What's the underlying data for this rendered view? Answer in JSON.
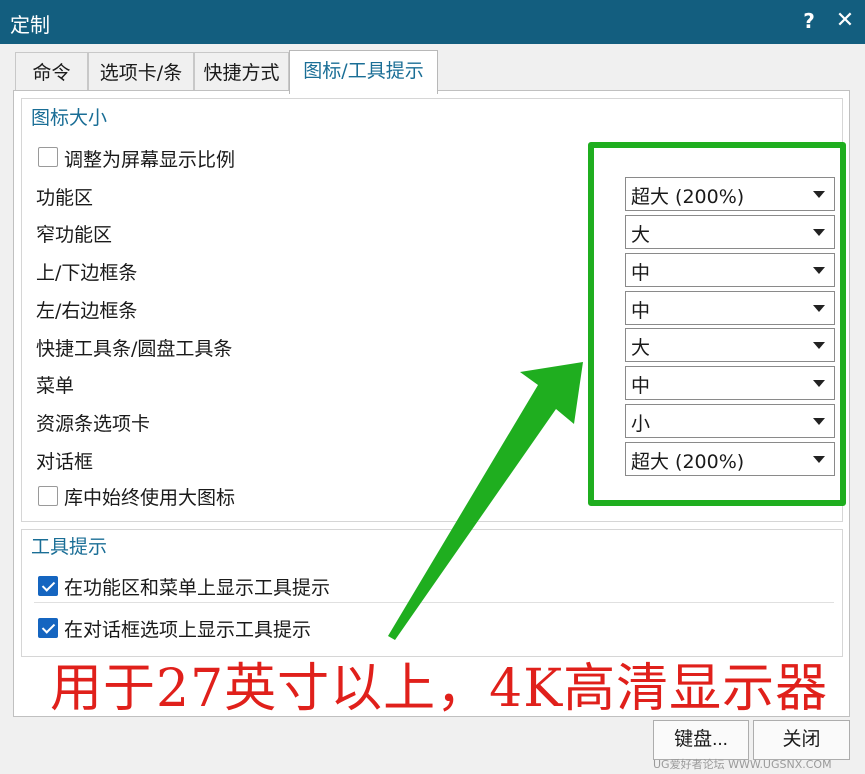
{
  "window": {
    "title": "定制",
    "help_label": "?",
    "close_label": "✕"
  },
  "tabs": [
    {
      "label": "命令"
    },
    {
      "label": "选项卡/条"
    },
    {
      "label": "快捷方式"
    },
    {
      "label": "图标/工具提示",
      "active": true
    }
  ],
  "icon_size": {
    "title": "图标大小",
    "scale_checkbox": {
      "label": "调整为屏幕显示比例",
      "checked": false
    },
    "rows": [
      {
        "label": "功能区",
        "value": "超大 (200%)"
      },
      {
        "label": "窄功能区",
        "value": "大"
      },
      {
        "label": "上/下边框条",
        "value": "中"
      },
      {
        "label": "左/右边框条",
        "value": "中"
      },
      {
        "label": "快捷工具条/圆盘工具条",
        "value": "大"
      },
      {
        "label": "菜单",
        "value": "中"
      },
      {
        "label": "资源条选项卡",
        "value": "小"
      },
      {
        "label": "对话框",
        "value": "超大 (200%)"
      }
    ],
    "library_checkbox": {
      "label": "库中始终使用大图标",
      "checked": false
    }
  },
  "tooltips": {
    "title": "工具提示",
    "options": [
      {
        "label": "在功能区和菜单上显示工具提示",
        "checked": true
      },
      {
        "label": "在对话框选项上显示工具提示",
        "checked": true
      }
    ]
  },
  "annotation": {
    "text": "用于27英寸以上，4K高清显示器",
    "box_color": "#1fae1f",
    "text_color": "#e0201b"
  },
  "buttons": {
    "keyboard": "键盘...",
    "close": "关闭"
  },
  "watermark": "UG爱好者论坛 WWW.UGSNX.COM",
  "colors": {
    "titlebar": "#135e7f",
    "accent": "#1a6e96",
    "checkbox_checked": "#1565c0"
  }
}
